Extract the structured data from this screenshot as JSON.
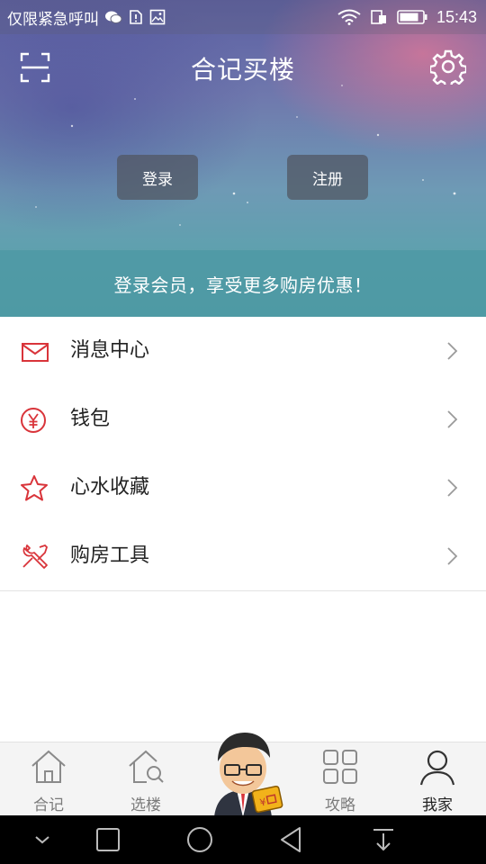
{
  "status_bar": {
    "carrier_text": "仅限紧急呼叫",
    "time": "15:43",
    "icons": [
      "wechat-icon",
      "warning-sim-icon",
      "image-icon",
      "wifi-icon",
      "data-icon",
      "battery-icon"
    ]
  },
  "header": {
    "title": "合记买楼",
    "left_icon": "scan-icon",
    "right_icon": "gear-icon"
  },
  "auth": {
    "login_label": "登录",
    "register_label": "注册"
  },
  "promo": {
    "text": "登录会员，享受更多购房优惠！"
  },
  "menu": {
    "items": [
      {
        "label": "消息中心",
        "icon": "mail-icon"
      },
      {
        "label": "钱包",
        "icon": "yen-coin-icon"
      },
      {
        "label": "心水收藏",
        "icon": "star-icon"
      },
      {
        "label": "购房工具",
        "icon": "tools-icon"
      }
    ]
  },
  "tabbar": {
    "tabs": [
      {
        "label": "合记",
        "icon": "home-icon",
        "active": false
      },
      {
        "label": "选楼",
        "icon": "house-search-icon",
        "active": false
      },
      {
        "label": "",
        "icon": "mascot-icon",
        "active": false
      },
      {
        "label": "攻略",
        "icon": "grid-icon",
        "active": false
      },
      {
        "label": "我家",
        "icon": "user-icon",
        "active": true
      }
    ]
  },
  "colors": {
    "accent_red": "#d9343a",
    "text_dark": "#222222",
    "tab_inactive": "#7b7b7b"
  }
}
